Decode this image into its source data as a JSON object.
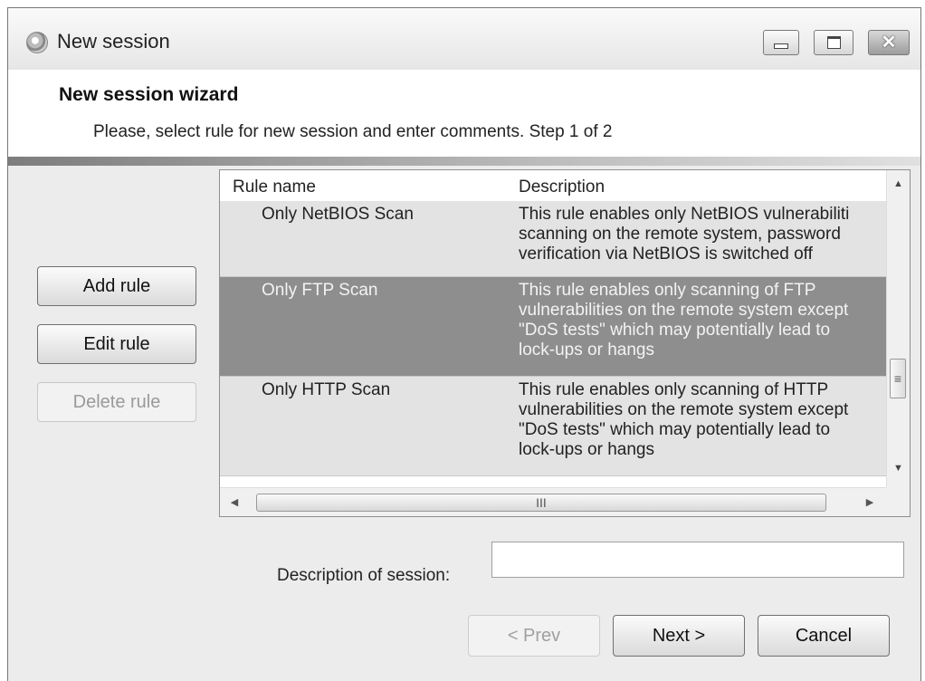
{
  "window": {
    "title": "New session",
    "icon": "scanner-app-icon"
  },
  "header": {
    "title": "New session wizard",
    "subtitle": "Please, select rule for new session and  enter comments. Step 1 of 2"
  },
  "side_buttons": {
    "add": "Add rule",
    "edit": "Edit rule",
    "delete": "Delete rule"
  },
  "rules_list": {
    "columns": [
      "Rule name",
      "Description"
    ],
    "rows": [
      {
        "name": "Only NetBIOS Scan",
        "desc": [
          "This rule enables only NetBIOS vulnerabiliti",
          "scanning on the remote system, password",
          "verification via NetBIOS is switched off"
        ]
      },
      {
        "name": "Only FTP Scan",
        "desc": [
          "This rule enables only scanning of FTP",
          "vulnerabilities on the remote system except",
          "\"DoS tests\" which may potentially lead to",
          "lock-ups or hangs"
        ],
        "selected": true
      },
      {
        "name": "Only HTTP Scan",
        "desc": [
          "This rule enables only scanning of HTTP",
          "vulnerabilities on the remote system except",
          "\"DoS tests\" which may potentially lead to",
          "lock-ups or hangs"
        ]
      }
    ]
  },
  "session_description": {
    "label": "Description of session:",
    "value": ""
  },
  "footer": {
    "prev": "< Prev",
    "next": "Next >",
    "cancel": "Cancel"
  },
  "colors": {
    "selected_row": "#8e8e8e",
    "row": "#e3e3e3",
    "dialog_bg": "#ececec"
  }
}
